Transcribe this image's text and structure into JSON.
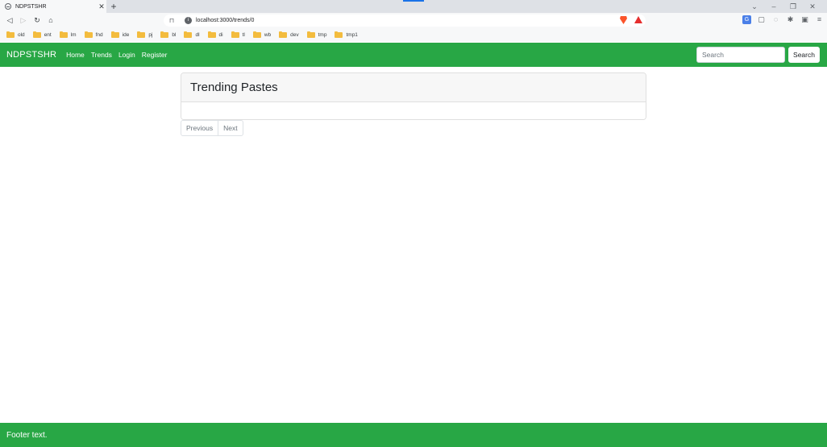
{
  "browser": {
    "tab_title": "NDPSTSHR",
    "tab_close": "✕",
    "new_tab": "+",
    "url": "localhost:3000/trends/0",
    "bookmarks": [
      "old",
      "ent",
      "lm",
      "fnd",
      "ide",
      "pj",
      "bl",
      "dl",
      "di",
      "tl",
      "wb",
      "dev",
      "tmp",
      "tmp1"
    ]
  },
  "navbar": {
    "brand": "NDPSTSHR",
    "links": [
      "Home",
      "Trends",
      "Login",
      "Register"
    ],
    "search_placeholder": "Search",
    "search_button": "Search",
    "color": "#28a745"
  },
  "main": {
    "title": "Trending Pastes",
    "pagination": {
      "previous": "Previous",
      "next": "Next"
    }
  },
  "footer": {
    "text": "Footer text."
  }
}
